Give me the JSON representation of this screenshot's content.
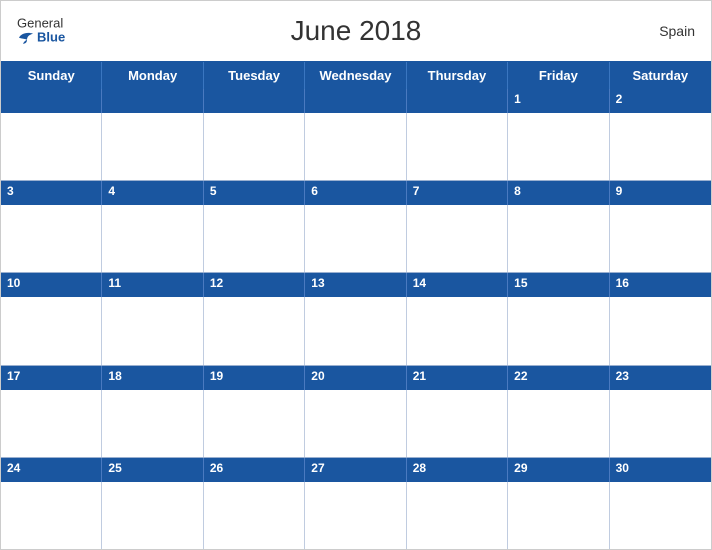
{
  "header": {
    "title": "June 2018",
    "country": "Spain",
    "logo": {
      "general": "General",
      "blue": "Blue"
    }
  },
  "days": {
    "headers": [
      "Sunday",
      "Monday",
      "Tuesday",
      "Wednesday",
      "Thursday",
      "Friday",
      "Saturday"
    ]
  },
  "weeks": [
    {
      "days": [
        "",
        "",
        "",
        "",
        "",
        "1",
        "2"
      ]
    },
    {
      "days": [
        "3",
        "4",
        "5",
        "6",
        "7",
        "8",
        "9"
      ]
    },
    {
      "days": [
        "10",
        "11",
        "12",
        "13",
        "14",
        "15",
        "16"
      ]
    },
    {
      "days": [
        "17",
        "18",
        "19",
        "20",
        "21",
        "22",
        "23"
      ]
    },
    {
      "days": [
        "24",
        "25",
        "26",
        "27",
        "28",
        "29",
        "30"
      ]
    }
  ],
  "colors": {
    "blue": "#1a56a0",
    "white": "#ffffff",
    "border": "#c0cce0"
  }
}
